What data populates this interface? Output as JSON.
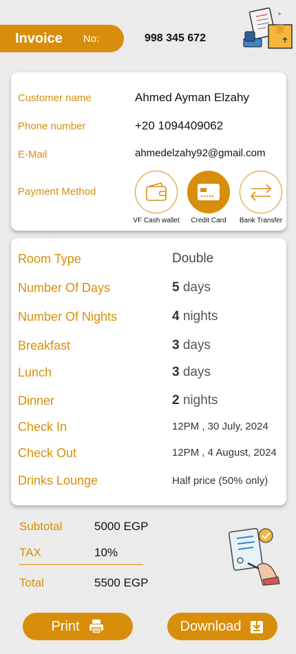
{
  "header": {
    "title": "Invoice",
    "no_label": "No:",
    "number": "998 345 672"
  },
  "customer": {
    "fields": [
      {
        "label": "Customer name",
        "value": "Ahmed Ayman Elzahy"
      },
      {
        "label": "Phone number",
        "value": "+20 1094409062"
      },
      {
        "label": "E-Mail",
        "value": "ahmedelzahy92@gmail.com"
      }
    ],
    "payment_label": "Payment Method",
    "payment_options": [
      {
        "label": "VF Cash wallet",
        "icon": "wallet-icon",
        "selected": false
      },
      {
        "label": "Credit Card",
        "icon": "credit-card-icon",
        "selected": true
      },
      {
        "label": "Bank Transfer",
        "icon": "transfer-arrows-icon",
        "selected": false
      }
    ]
  },
  "booking": {
    "room_type": {
      "label": "Room Type",
      "value": "Double"
    },
    "days": {
      "label": "Number Of Days",
      "num": "5",
      "unit": "days"
    },
    "nights": {
      "label": "Number Of Nights",
      "num": "4",
      "unit": "nights"
    },
    "breakfast": {
      "label": "Breakfast",
      "num": "3",
      "unit": "days"
    },
    "lunch": {
      "label": "Lunch",
      "num": "3",
      "unit": "days"
    },
    "dinner": {
      "label": "Dinner",
      "num": "2",
      "unit": "nights"
    },
    "check_in": {
      "label": "Check In",
      "value": "12PM , 30 July, 2024"
    },
    "check_out": {
      "label": "Check Out",
      "value": "12PM , 4 August, 2024"
    },
    "drinks": {
      "label": "Drinks Lounge",
      "value": "Half price (50% only)"
    }
  },
  "totals": {
    "subtotal": {
      "label": "Subtotal",
      "value": "5000 EGP"
    },
    "tax": {
      "label": "TAX",
      "value": "10%"
    },
    "total": {
      "label": "Total",
      "value": "5500 EGP"
    }
  },
  "actions": {
    "print_label": "Print",
    "download_label": "Download"
  },
  "colors": {
    "accent": "#d88e0b",
    "background": "#ebebeb",
    "card": "#ffffff"
  }
}
